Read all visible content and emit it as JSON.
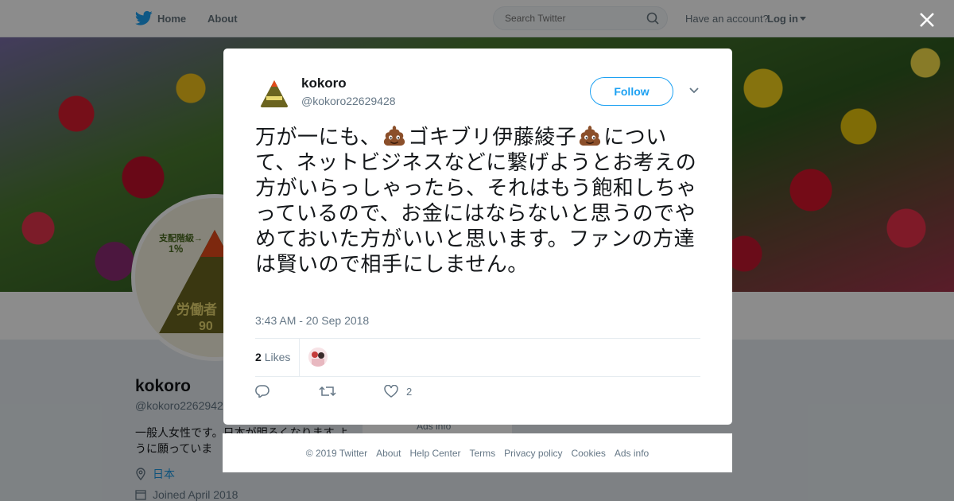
{
  "topbar": {
    "home_label": "Home",
    "about_label": "About",
    "search_placeholder": "Search Twitter",
    "account_prompt": "Have an account?",
    "login_label": "Log in"
  },
  "profile": {
    "name": "kokoro",
    "handle": "@kokoro2262942",
    "bio": "一般人女性です。日本が明るくなります ように願っていま",
    "location": "日本",
    "joined": "Joined April 2018",
    "avatar_text_top": "支配階級→",
    "avatar_text_pct": "1％",
    "avatar_text_bottom": "労働者",
    "avatar_text_num": "90"
  },
  "background": {
    "ads_info": "Ads info"
  },
  "tweet": {
    "name": "kokoro",
    "handle": "@kokoro22629428",
    "follow_label": "Follow",
    "text_part1": "万が一にも、",
    "text_part2": "ゴキブリ伊藤綾子",
    "text_part3": "について、ネットビジネスなどに繋げようとお考えの方がいらっしゃったら、それはもう飽和しちゃっているので、お金にはならないと思うのでやめておいた方がいいと思います。ファンの方達は賢いので相手にしません。",
    "timestamp": "3:43 AM - 20 Sep 2018",
    "likes_count": "2",
    "likes_label": "Likes",
    "like_action_count": "2"
  },
  "footer": {
    "links": [
      "© 2019 Twitter",
      "About",
      "Help Center",
      "Terms",
      "Privacy policy",
      "Cookies",
      "Ads info"
    ]
  },
  "colors": {
    "twitter_blue": "#1da1f2",
    "link_blue": "#1b95e0",
    "overlay": "rgba(0,0,0,0.45)"
  }
}
